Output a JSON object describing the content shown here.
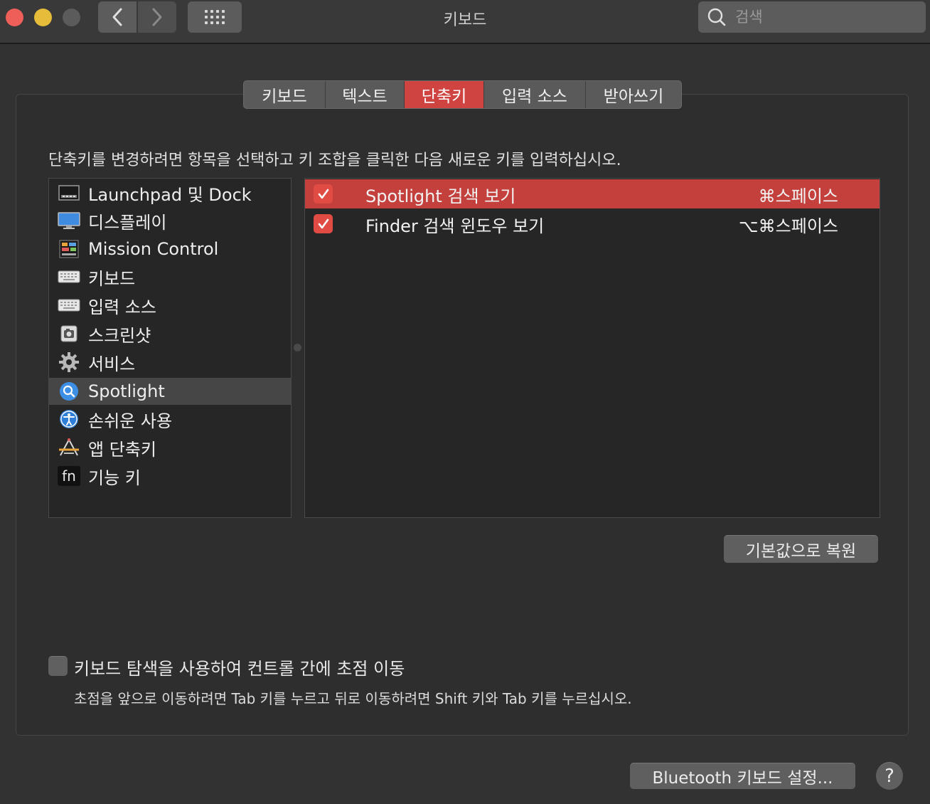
{
  "window": {
    "title": "키보드",
    "search_placeholder": "검색"
  },
  "tabs": [
    {
      "label": "키보드"
    },
    {
      "label": "텍스트"
    },
    {
      "label": "단축키",
      "selected": true
    },
    {
      "label": "입력 소스"
    },
    {
      "label": "받아쓰기"
    }
  ],
  "instruction": "단축키를 변경하려면 항목을 선택하고 키 조합을 클릭한 다음 새로운 키를 입력하십시오.",
  "categories": [
    {
      "label": "Launchpad 및 Dock",
      "icon": "launchpad-dock-icon"
    },
    {
      "label": "디스플레이",
      "icon": "display-icon"
    },
    {
      "label": "Mission Control",
      "icon": "mission-control-icon"
    },
    {
      "label": "키보드",
      "icon": "keyboard-icon"
    },
    {
      "label": "입력 소스",
      "icon": "input-source-icon"
    },
    {
      "label": "스크린샷",
      "icon": "screenshot-icon"
    },
    {
      "label": "서비스",
      "icon": "gear-icon"
    },
    {
      "label": "Spotlight",
      "icon": "spotlight-icon",
      "selected": true
    },
    {
      "label": "손쉬운 사용",
      "icon": "accessibility-icon"
    },
    {
      "label": "앱 단축키",
      "icon": "app-shortcuts-icon"
    },
    {
      "label": "기능 키",
      "icon": "fn-key-icon",
      "glyph": "fn"
    }
  ],
  "shortcuts": [
    {
      "name": "Spotlight 검색 보기",
      "key": "⌘스페이스",
      "checked": true,
      "selected": true
    },
    {
      "name": "Finder 검색 윈도우 보기",
      "key": "⌥⌘스페이스",
      "checked": true,
      "selected": false
    }
  ],
  "buttons": {
    "restore_defaults": "기본값으로 복원",
    "bluetooth_setup": "Bluetooth 키보드 설정...",
    "help": "?"
  },
  "keyboard_navigation": {
    "label": "키보드 탐색을 사용하여 컨트롤 간에 초점 이동",
    "description": "초점을 앞으로 이동하려면 Tab 키를 누르고 뒤로 이동하려면 Shift 키와 Tab 키를 누르십시오.",
    "checked": false
  },
  "colors": {
    "accent": "#cf4440",
    "checkbox": "#e04b44",
    "background": "#323232"
  }
}
